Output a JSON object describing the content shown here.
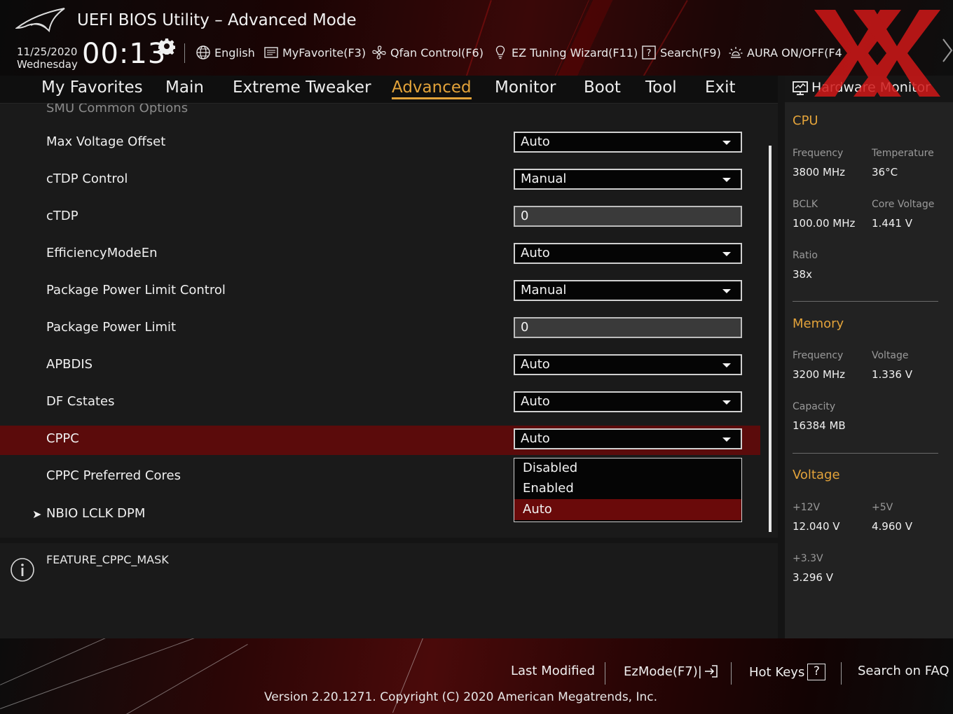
{
  "header": {
    "title": "UEFI BIOS Utility – Advanced Mode",
    "date": "11/25/2020",
    "weekday": "Wednesday",
    "time": "00:13",
    "toolbar": {
      "language": "English",
      "myfavorite": "MyFavorite(F3)",
      "qfan": "Qfan Control(F6)",
      "ez_tuning": "EZ Tuning Wizard(F11)",
      "search": "Search(F9)",
      "aura": "AURA ON/OFF(F4"
    }
  },
  "nav": {
    "tabs": [
      "My Favorites",
      "Main",
      "Extreme Tweaker",
      "Advanced",
      "Monitor",
      "Boot",
      "Tool",
      "Exit"
    ],
    "active": "Advanced"
  },
  "settings": {
    "section_cut": "SMU Common Options",
    "rows": [
      {
        "label": "Max Voltage Offset",
        "value": "Auto"
      },
      {
        "label": "cTDP Control",
        "value": "Manual"
      },
      {
        "label": "cTDP",
        "value": "0"
      },
      {
        "label": "EfficiencyModeEn",
        "value": "Auto"
      },
      {
        "label": "Package Power Limit Control",
        "value": "Manual"
      },
      {
        "label": "Package Power Limit",
        "value": "0"
      },
      {
        "label": "APBDIS",
        "value": "Auto"
      },
      {
        "label": "DF Cstates",
        "value": "Auto"
      },
      {
        "label": "CPPC",
        "value": "Auto"
      },
      {
        "label": "CPPC Preferred Cores",
        "value": ""
      },
      {
        "label": "NBIO LCLK DPM",
        "value": ""
      }
    ],
    "dropdown_options": [
      "Disabled",
      "Enabled",
      "Auto"
    ],
    "dropdown_selected": "Auto"
  },
  "help": {
    "text": "FEATURE_CPPC_MASK"
  },
  "hw_monitor": {
    "title": "Hardware Monitor",
    "cpu": {
      "heading": "CPU",
      "frequency_label": "Frequency",
      "frequency": "3800 MHz",
      "temperature_label": "Temperature",
      "temperature": "36°C",
      "bclk_label": "BCLK",
      "bclk": "100.00 MHz",
      "core_voltage_label": "Core Voltage",
      "core_voltage": "1.441 V",
      "ratio_label": "Ratio",
      "ratio": "38x"
    },
    "memory": {
      "heading": "Memory",
      "frequency_label": "Frequency",
      "frequency": "3200 MHz",
      "voltage_label": "Voltage",
      "voltage": "1.336 V",
      "capacity_label": "Capacity",
      "capacity": "16384 MB"
    },
    "voltage": {
      "heading": "Voltage",
      "v12_label": "+12V",
      "v12": "12.040 V",
      "v5_label": "+5V",
      "v5": "4.960 V",
      "v33_label": "+3.3V",
      "v33": "3.296 V"
    }
  },
  "footer": {
    "last_modified": "Last Modified",
    "ezmode": "EzMode(F7)|",
    "hot_keys": "Hot Keys",
    "hot_keys_key": "?",
    "faq": "Search on FAQ",
    "version": "Version 2.20.1271. Copyright (C) 2020 American Megatrends, Inc."
  },
  "colors": {
    "accent": "#e3a33a",
    "selected_row": "#5b0b0b",
    "selected_option": "#6a0a0a",
    "watermark": "#d01818"
  }
}
